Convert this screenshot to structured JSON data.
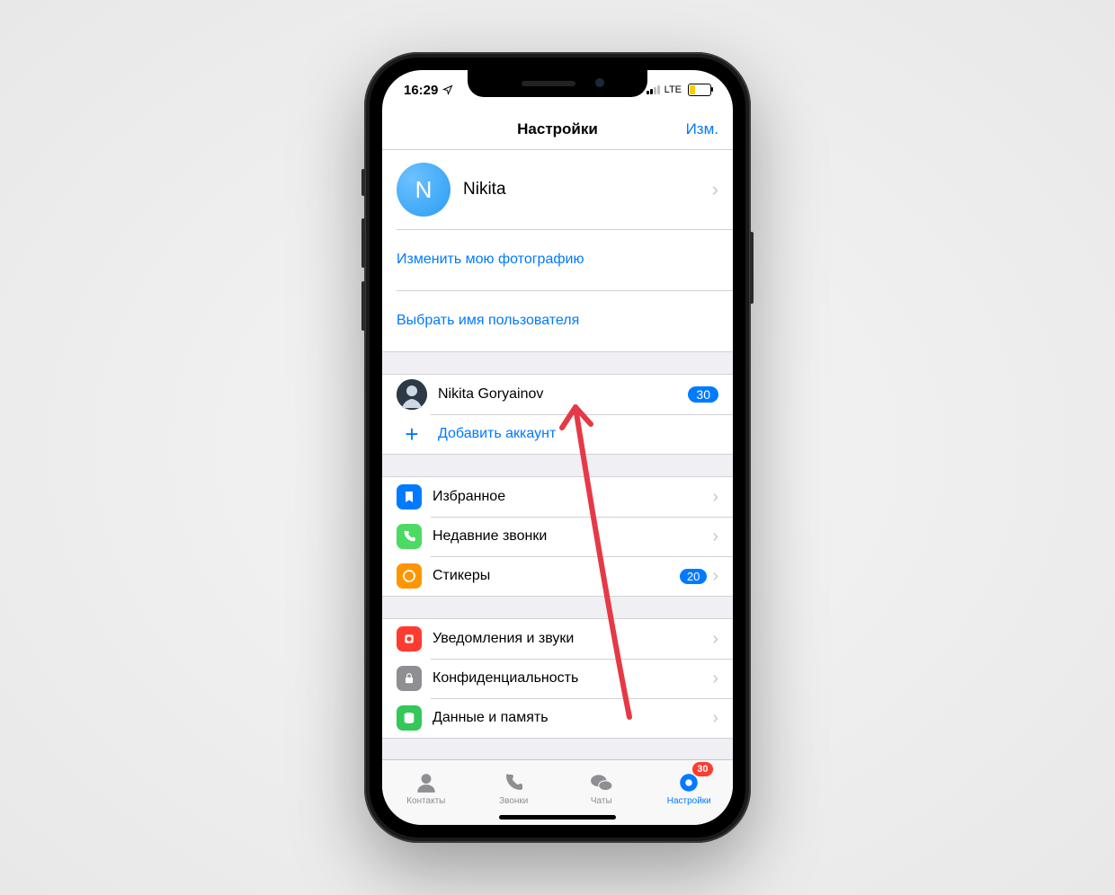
{
  "statusbar": {
    "time": "16:29",
    "network": "LTE"
  },
  "nav": {
    "title": "Настройки",
    "edit": "Изм."
  },
  "profile": {
    "initial": "N",
    "name": "Nikita"
  },
  "links": {
    "changePhoto": "Изменить мою фотографию",
    "chooseUsername": "Выбрать имя пользователя"
  },
  "accounts": {
    "list": [
      {
        "name": "Nikita Goryainov",
        "badge": "30"
      }
    ],
    "add": "Добавить аккаунт"
  },
  "settings1": [
    {
      "label": "Избранное",
      "icon": "bookmark",
      "color": "ic-blue"
    },
    {
      "label": "Недавние звонки",
      "icon": "phone",
      "color": "ic-green"
    },
    {
      "label": "Стикеры",
      "icon": "sticker",
      "color": "ic-orange",
      "badge": "20"
    }
  ],
  "settings2": [
    {
      "label": "Уведомления и звуки",
      "icon": "bell",
      "color": "ic-red"
    },
    {
      "label": "Конфиденциальность",
      "icon": "lock",
      "color": "ic-gray"
    },
    {
      "label": "Данные и память",
      "icon": "data",
      "color": "ic-teal"
    }
  ],
  "tabs": {
    "contacts": "Контакты",
    "calls": "Звонки",
    "chats": "Чаты",
    "settings": "Настройки",
    "badge": "30"
  }
}
